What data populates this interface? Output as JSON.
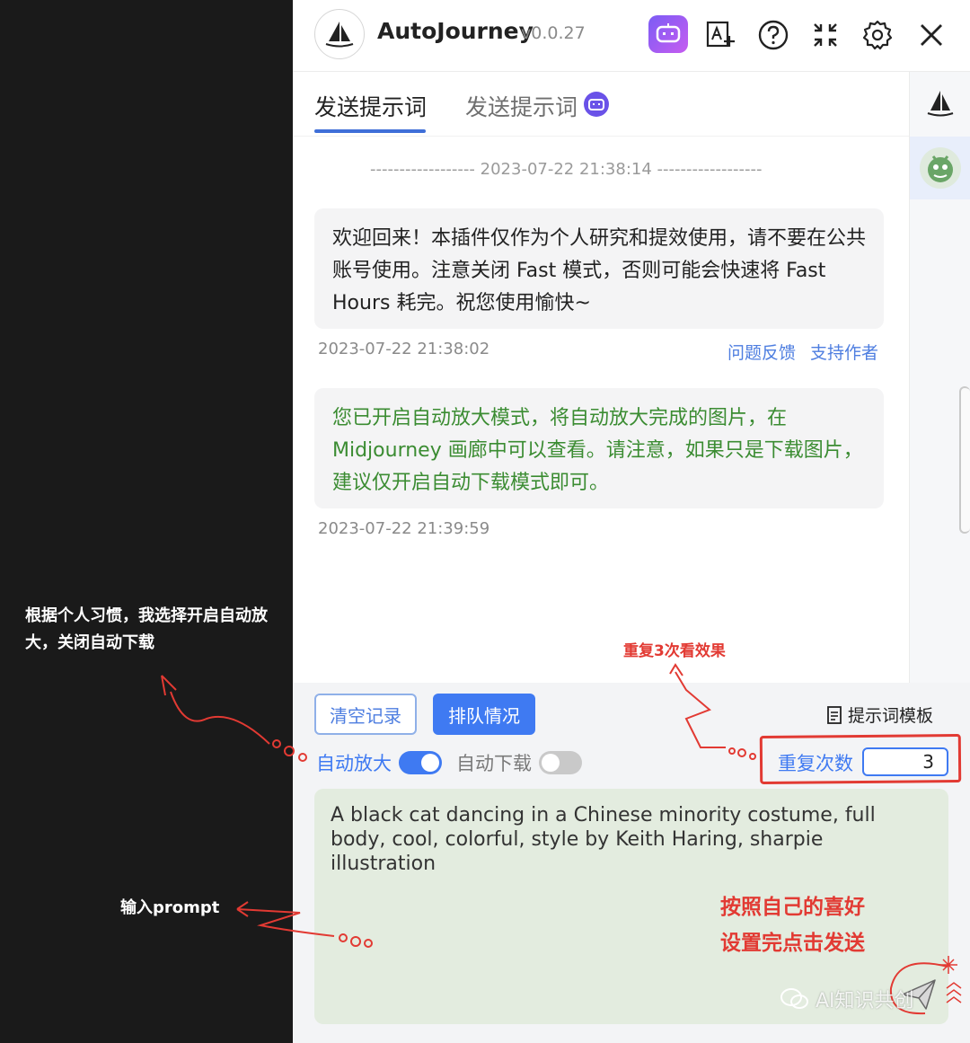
{
  "annotations": {
    "note_toggles": "根据个人习惯，我选择开启自动放大，关闭自动下载",
    "note_prompt": "输入prompt",
    "note_repeat": "重复3次看效果",
    "note_pref_line1": "按照自己的喜好",
    "note_pref_line2": "设置完点击发送"
  },
  "header": {
    "title": "AutoJourney",
    "version": "v0.0.27",
    "icons": [
      "bot-icon",
      "translate-icon",
      "help-icon",
      "fullscreen-icon",
      "gear-icon",
      "close-icon"
    ]
  },
  "tabs": [
    {
      "label": "发送提示词",
      "active": true
    },
    {
      "label": "发送提示词",
      "active": false
    }
  ],
  "chat": {
    "divider": "------------------ 2023-07-22 21:38:14 ------------------",
    "messages": [
      {
        "text": "欢迎回来！本插件仅作为个人研究和提效使用，请不要在公共账号使用。注意关闭 Fast 模式，否则可能会快速将 Fast Hours 耗完。祝您使用愉快~",
        "time": "2023-07-22 21:38:02",
        "links": [
          "问题反馈",
          "支持作者"
        ]
      },
      {
        "text": "您已开启自动放大模式，将自动放大完成的图片，在 Midjourney 画廊中可以查看。请注意，如果只是下载图片，建议仅开启自动下载模式即可。",
        "time": "2023-07-22 21:39:59"
      }
    ]
  },
  "controls": {
    "clear_label": "清空记录",
    "queue_label": "排队情况",
    "template_label": "提示词模板",
    "auto_upscale_label": "自动放大",
    "auto_upscale_on": true,
    "auto_download_label": "自动下载",
    "auto_download_on": false,
    "repeat_label": "重复次数",
    "repeat_value": "3",
    "prompt_text": "A black cat dancing in a Chinese minority costume, full body, cool, colorful,  style by Keith Haring, sharpie illustration"
  },
  "watermark": "AI知识共创",
  "colors": {
    "accent": "#3f7af2",
    "system_message": "#3b8c32",
    "annotation_red": "#e23a33",
    "prompt_bg": "#e3ecdf"
  }
}
